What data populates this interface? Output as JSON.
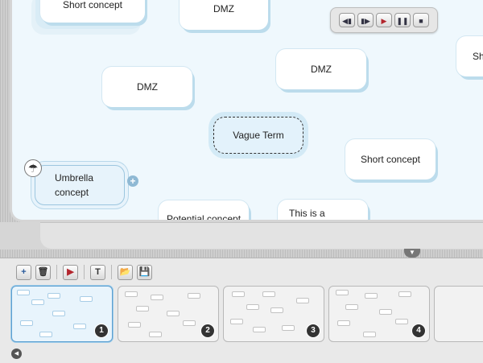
{
  "canvas": {
    "nodes": [
      {
        "id": "short-concept-top",
        "label": "Short concept"
      },
      {
        "id": "dmz-top",
        "label": "DMZ"
      },
      {
        "id": "dmz-left",
        "label": "DMZ"
      },
      {
        "id": "dmz-right",
        "label": "DMZ"
      },
      {
        "id": "sh-edge",
        "label": "Sh"
      },
      {
        "id": "vague-term",
        "label": "Vague Term"
      },
      {
        "id": "short-concept-right",
        "label": "Short concept"
      },
      {
        "id": "umbrella-concept",
        "label": "Umbrella concept"
      },
      {
        "id": "potential-concept",
        "label": "Potential concept"
      },
      {
        "id": "this-is-a",
        "label": "This is a"
      }
    ]
  },
  "player": {
    "buttons": [
      "skip-back",
      "step-forward",
      "play",
      "pause",
      "stop"
    ],
    "glyphs": {
      "skip_back": "◀▮",
      "step_forward": "▮▶",
      "play": "▶",
      "pause": "❚❚",
      "stop": "■"
    }
  },
  "toolbar": {
    "glyphs": {
      "add": "+",
      "delete": "🗑",
      "play": "▶",
      "text": "T",
      "open": "📂",
      "save": "💾"
    }
  },
  "slides": [
    {
      "number": "1",
      "active": true
    },
    {
      "number": "2",
      "active": false
    },
    {
      "number": "3",
      "active": false
    },
    {
      "number": "4",
      "active": false
    }
  ],
  "colors": {
    "canvas_bg": "#eff8fd",
    "accent_blue": "#5d9fd0",
    "play_red": "#b3262e"
  }
}
